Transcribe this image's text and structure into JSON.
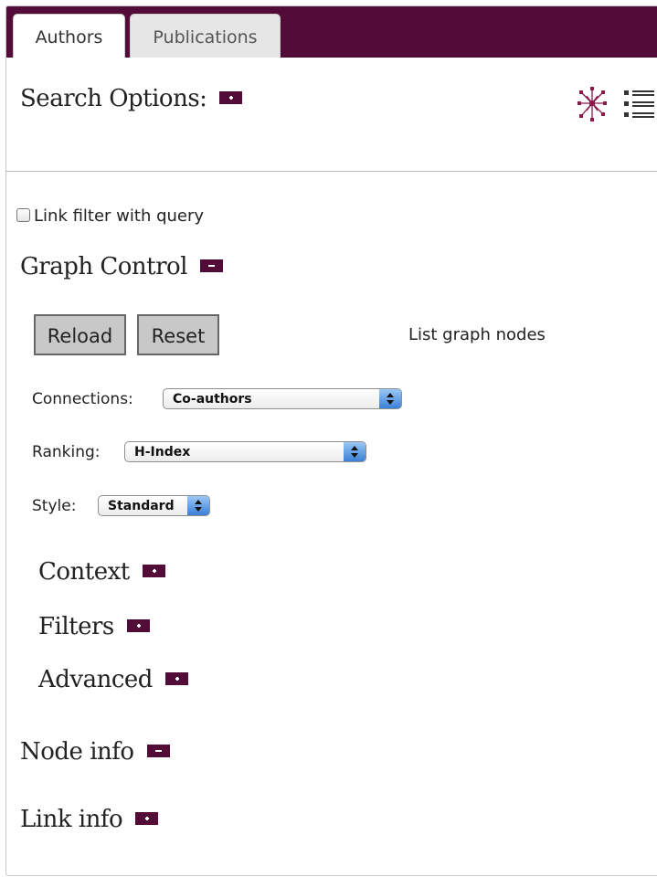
{
  "tabs": [
    {
      "label": "Authors",
      "active": true
    },
    {
      "label": "Publications",
      "active": false
    }
  ],
  "search_options": {
    "label": "Search Options:",
    "toggle": "plus"
  },
  "link_filter": {
    "label": "Link filter with query",
    "checked": false
  },
  "graph_control": {
    "label": "Graph Control",
    "toggle": "minus",
    "reload_label": "Reload",
    "reset_label": "Reset",
    "list_nodes_label": "List graph nodes",
    "connections": {
      "label": "Connections:",
      "value": "Co-authors"
    },
    "ranking": {
      "label": "Ranking:",
      "value": "H-Index"
    },
    "style": {
      "label": "Style:",
      "value": "Standard"
    },
    "subsections": [
      {
        "label": "Context",
        "toggle": "plus"
      },
      {
        "label": "Filters",
        "toggle": "plus"
      },
      {
        "label": "Advanced",
        "toggle": "plus"
      }
    ]
  },
  "node_info": {
    "label": "Node info",
    "toggle": "minus"
  },
  "link_info": {
    "label": "Link info",
    "toggle": "plus"
  },
  "colors": {
    "accent": "#520c37",
    "button_bg": "#c8c8c8"
  },
  "icons": {
    "graph_view": "graph-network-icon",
    "list_view": "list-view-icon"
  }
}
